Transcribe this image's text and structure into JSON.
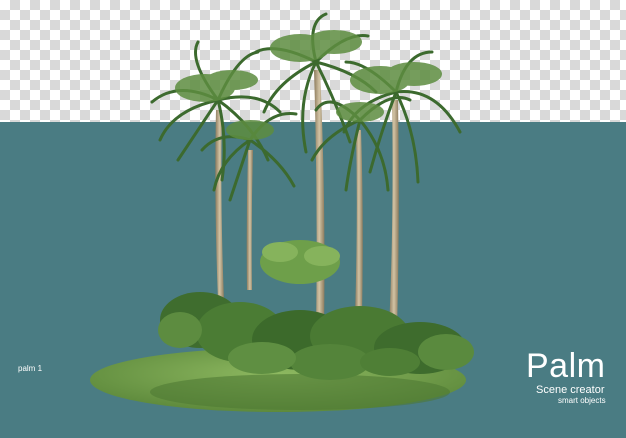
{
  "labels": {
    "item_label": "palm 1",
    "title": "Palm",
    "subtitle": "Scene creator",
    "tagline": "smart objects"
  },
  "colors": {
    "teal_background": "#4a7c83",
    "checker_light": "#ffffff",
    "checker_dark": "#d9d9d9",
    "grass": "#7da451",
    "foliage_dark": "#3e6a2c",
    "foliage_light": "#7fa85a",
    "trunk": "#b9a888",
    "text": "#ffffff"
  }
}
